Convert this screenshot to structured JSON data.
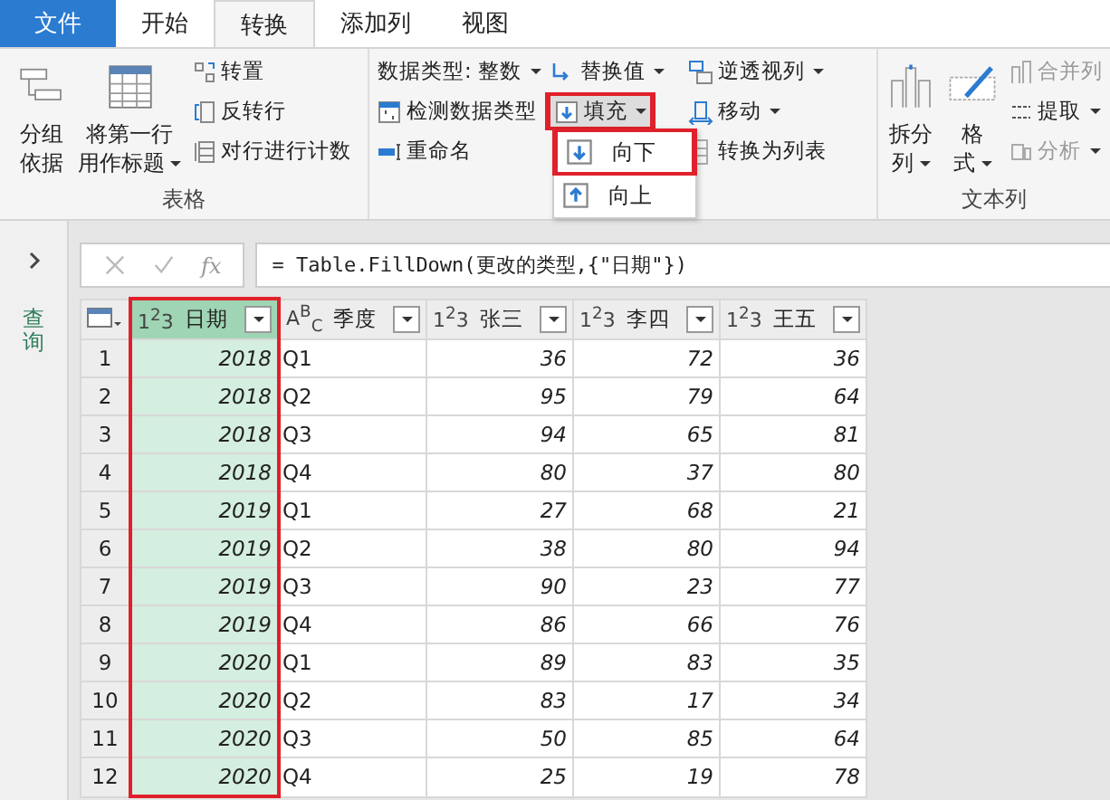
{
  "tabs": [
    {
      "label": "文件",
      "kind": "file",
      "selected": false
    },
    {
      "label": "开始",
      "kind": "tab",
      "selected": false
    },
    {
      "label": "转换",
      "kind": "tab",
      "selected": true
    },
    {
      "label": "添加列",
      "kind": "tab",
      "selected": false
    },
    {
      "label": "视图",
      "kind": "tab",
      "selected": false
    }
  ],
  "ribbon": {
    "groups": [
      {
        "label": "表格",
        "large_buttons": [
          {
            "lines": [
              "分组",
              "依据"
            ],
            "dropdown": false
          },
          {
            "lines": [
              "将第一行",
              "用作标题"
            ],
            "dropdown": true
          }
        ],
        "columns": [
          [
            {
              "label": "转置",
              "dropdown": false,
              "disabled": false,
              "pressed": false,
              "highlighted": false
            },
            {
              "label": "反转行",
              "dropdown": false,
              "disabled": false,
              "pressed": false,
              "highlighted": false
            },
            {
              "label": "对行进行计数",
              "dropdown": false,
              "disabled": false,
              "pressed": false,
              "highlighted": false
            }
          ]
        ]
      },
      {
        "columns": [
          [
            {
              "label": "数据类型: 整数",
              "dropdown": true,
              "disabled": false,
              "pressed": false,
              "highlighted": false
            },
            {
              "label": "检测数据类型",
              "dropdown": false,
              "disabled": false,
              "pressed": false,
              "highlighted": false
            },
            {
              "label": "重命名",
              "dropdown": false,
              "disabled": false,
              "pressed": false,
              "highlighted": false
            }
          ],
          [
            {
              "label": "替换值",
              "dropdown": true,
              "disabled": false,
              "pressed": false,
              "highlighted": false
            },
            {
              "label": "填充",
              "dropdown": true,
              "disabled": false,
              "pressed": true,
              "highlighted": true
            }
          ],
          [
            {
              "label": "逆透视列",
              "dropdown": true,
              "disabled": false,
              "pressed": false,
              "highlighted": false
            },
            {
              "label": "移动",
              "dropdown": true,
              "disabled": false,
              "pressed": false,
              "highlighted": false
            },
            {
              "label": "转换为列表",
              "dropdown": false,
              "disabled": false,
              "pressed": false,
              "highlighted": false
            }
          ]
        ]
      },
      {
        "label": "文本列",
        "large_buttons": [
          {
            "lines": [
              "拆分",
              "列"
            ],
            "dropdown": true
          },
          {
            "lines": [
              "格",
              "式"
            ],
            "dropdown": true
          }
        ],
        "columns": [
          [
            {
              "label": "合并列",
              "dropdown": false,
              "disabled": true,
              "pressed": false,
              "highlighted": false
            },
            {
              "label": "提取",
              "dropdown": true,
              "disabled": false,
              "pressed": false,
              "highlighted": false
            },
            {
              "label": "分析",
              "dropdown": true,
              "disabled": true,
              "pressed": false,
              "highlighted": false
            }
          ]
        ]
      }
    ]
  },
  "fill_menu": {
    "items": [
      {
        "label": "向下",
        "highlighted": true
      },
      {
        "label": "向上",
        "highlighted": false
      }
    ]
  },
  "sidebar": {
    "title": "查询"
  },
  "formula_bar": {
    "fx": "fx",
    "formula": "= Table.FillDown(更改的类型,{\"日期\"})"
  },
  "table": {
    "columns": [
      {
        "type_label": "1$^{2}$3",
        "name": "日期",
        "kind": "number",
        "selected": true,
        "highlighted": true
      },
      {
        "type_label": "A$^{B}$$_{C}$",
        "name": "季度",
        "kind": "text",
        "selected": false,
        "highlighted": false
      },
      {
        "type_label": "1$^{2}$3",
        "name": "张三",
        "kind": "number",
        "selected": false,
        "highlighted": false
      },
      {
        "type_label": "1$^{2}$3",
        "name": "李四",
        "kind": "number",
        "selected": false,
        "highlighted": false
      },
      {
        "type_label": "1$^{2}$3",
        "name": "王五",
        "kind": "number",
        "selected": false,
        "highlighted": false
      }
    ],
    "rows": [
      {
        "row_number": "1",
        "cells": [
          "2018",
          "Q1",
          "36",
          "72",
          "36"
        ]
      },
      {
        "row_number": "2",
        "cells": [
          "2018",
          "Q2",
          "95",
          "79",
          "64"
        ]
      },
      {
        "row_number": "3",
        "cells": [
          "2018",
          "Q3",
          "94",
          "65",
          "81"
        ]
      },
      {
        "row_number": "4",
        "cells": [
          "2018",
          "Q4",
          "80",
          "37",
          "80"
        ]
      },
      {
        "row_number": "5",
        "cells": [
          "2019",
          "Q1",
          "27",
          "68",
          "21"
        ]
      },
      {
        "row_number": "6",
        "cells": [
          "2019",
          "Q2",
          "38",
          "80",
          "94"
        ]
      },
      {
        "row_number": "7",
        "cells": [
          "2019",
          "Q3",
          "90",
          "23",
          "77"
        ]
      },
      {
        "row_number": "8",
        "cells": [
          "2019",
          "Q4",
          "86",
          "66",
          "76"
        ]
      },
      {
        "row_number": "9",
        "cells": [
          "2020",
          "Q1",
          "89",
          "83",
          "35"
        ]
      },
      {
        "row_number": "10",
        "cells": [
          "2020",
          "Q2",
          "83",
          "17",
          "34"
        ]
      },
      {
        "row_number": "11",
        "cells": [
          "2020",
          "Q3",
          "50",
          "85",
          "64"
        ]
      },
      {
        "row_number": "12",
        "cells": [
          "2020",
          "Q4",
          "25",
          "19",
          "78"
        ]
      }
    ]
  }
}
